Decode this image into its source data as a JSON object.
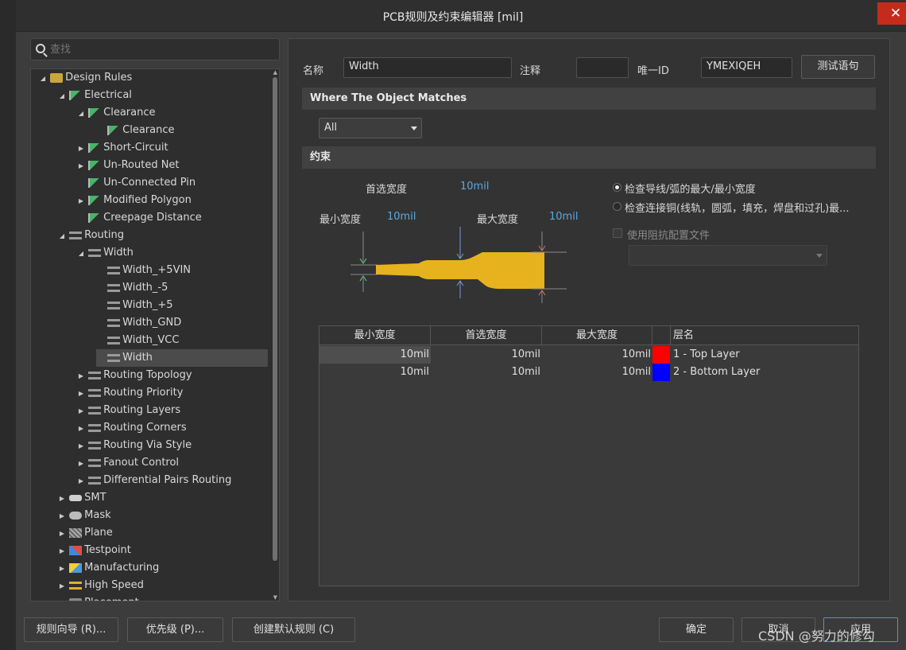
{
  "window": {
    "title": "PCB规则及约束编辑器 [mil]",
    "close_label": "✕"
  },
  "search": {
    "placeholder": "查找"
  },
  "tree": {
    "items": [
      {
        "label": "Design Rules",
        "arrow": "◢",
        "icon": "folder-rules-icon"
      },
      {
        "label": "Electrical",
        "arrow": "◢",
        "icon": "electrical-rule-icon"
      },
      {
        "label": "Clearance",
        "arrow": "◢",
        "icon": "electrical-rule-icon"
      },
      {
        "label": "Clearance",
        "arrow": "",
        "icon": "electrical-rule-icon"
      },
      {
        "label": "Short-Circuit",
        "arrow": "▶",
        "icon": "electrical-rule-icon"
      },
      {
        "label": "Un-Routed Net",
        "arrow": "▶",
        "icon": "electrical-rule-icon"
      },
      {
        "label": "Un-Connected Pin",
        "arrow": "",
        "icon": "electrical-rule-icon"
      },
      {
        "label": "Modified Polygon",
        "arrow": "▶",
        "icon": "electrical-rule-icon"
      },
      {
        "label": "Creepage Distance",
        "arrow": "",
        "icon": "electrical-rule-icon"
      },
      {
        "label": "Routing",
        "arrow": "◢",
        "icon": "routing-rule-icon"
      },
      {
        "label": "Width",
        "arrow": "◢",
        "icon": "routing-rule-icon"
      },
      {
        "label": "Width_+5VIN",
        "arrow": "",
        "icon": "routing-rule-icon"
      },
      {
        "label": "Width_-5",
        "arrow": "",
        "icon": "routing-rule-icon"
      },
      {
        "label": "Width_+5",
        "arrow": "",
        "icon": "routing-rule-icon"
      },
      {
        "label": "Width_GND",
        "arrow": "",
        "icon": "routing-rule-icon"
      },
      {
        "label": "Width_VCC",
        "arrow": "",
        "icon": "routing-rule-icon"
      },
      {
        "label": "Width",
        "arrow": "",
        "icon": "routing-rule-icon"
      },
      {
        "label": "Routing Topology",
        "arrow": "▶",
        "icon": "routing-rule-icon"
      },
      {
        "label": "Routing Priority",
        "arrow": "▶",
        "icon": "routing-rule-icon"
      },
      {
        "label": "Routing Layers",
        "arrow": "▶",
        "icon": "routing-rule-icon"
      },
      {
        "label": "Routing Corners",
        "arrow": "▶",
        "icon": "routing-rule-icon"
      },
      {
        "label": "Routing Via Style",
        "arrow": "▶",
        "icon": "routing-rule-icon"
      },
      {
        "label": "Fanout Control",
        "arrow": "▶",
        "icon": "routing-rule-icon"
      },
      {
        "label": "Differential Pairs Routing",
        "arrow": "▶",
        "icon": "routing-rule-icon"
      },
      {
        "label": "SMT",
        "arrow": "▶",
        "icon": "smt-rule-icon"
      },
      {
        "label": "Mask",
        "arrow": "▶",
        "icon": "mask-rule-icon"
      },
      {
        "label": "Plane",
        "arrow": "▶",
        "icon": "plane-rule-icon"
      },
      {
        "label": "Testpoint",
        "arrow": "▶",
        "icon": "testpoint-rule-icon"
      },
      {
        "label": "Manufacturing",
        "arrow": "▶",
        "icon": "manufacturing-rule-icon"
      },
      {
        "label": "High Speed",
        "arrow": "▶",
        "icon": "high-speed-rule-icon"
      },
      {
        "label": "Placement",
        "arrow": "▶",
        "icon": "placement-rule-icon"
      }
    ],
    "selected_index": 16
  },
  "rule": {
    "name_label": "名称",
    "name_value": "Width",
    "comment_label": "注释",
    "comment_value": "",
    "uid_label": "唯一ID",
    "uid_value": "YMEXIQEH",
    "test_button": "测试语句"
  },
  "match": {
    "section_title": "Where The Object Matches",
    "scope_value": "All"
  },
  "constraints": {
    "section_title": "约束",
    "preferred_label": "首选宽度",
    "preferred_value": "10mil",
    "min_label": "最小宽度",
    "min_value": "10mil",
    "max_label": "最大宽度",
    "max_value": "10mil",
    "radio_1": "检查导线/弧的最大/最小宽度",
    "radio_2": "检查连接铜(线轨，圆弧，填充，焊盘和过孔)最...",
    "radio_1_checked": true,
    "impedance_label": "使用阻抗配置文件",
    "trace_color": "#e6b21e"
  },
  "layer_table": {
    "headers": [
      "最小宽度",
      "首选宽度",
      "最大宽度",
      "",
      "层名"
    ],
    "rows": [
      {
        "min": "10mil",
        "pref": "10mil",
        "max": "10mil",
        "color": "#ff0000",
        "layer": "1 - Top Layer"
      },
      {
        "min": "10mil",
        "pref": "10mil",
        "max": "10mil",
        "color": "#0000ff",
        "layer": "2 - Bottom Layer"
      }
    ]
  },
  "footer": {
    "wizard": "规则向导 (R)...",
    "priority": "优先级 (P)...",
    "create_default": "创建默认规则 (C)",
    "ok": "确定",
    "cancel": "取消",
    "apply": "应用",
    "watermark": "CSDN @努力的修勾"
  }
}
